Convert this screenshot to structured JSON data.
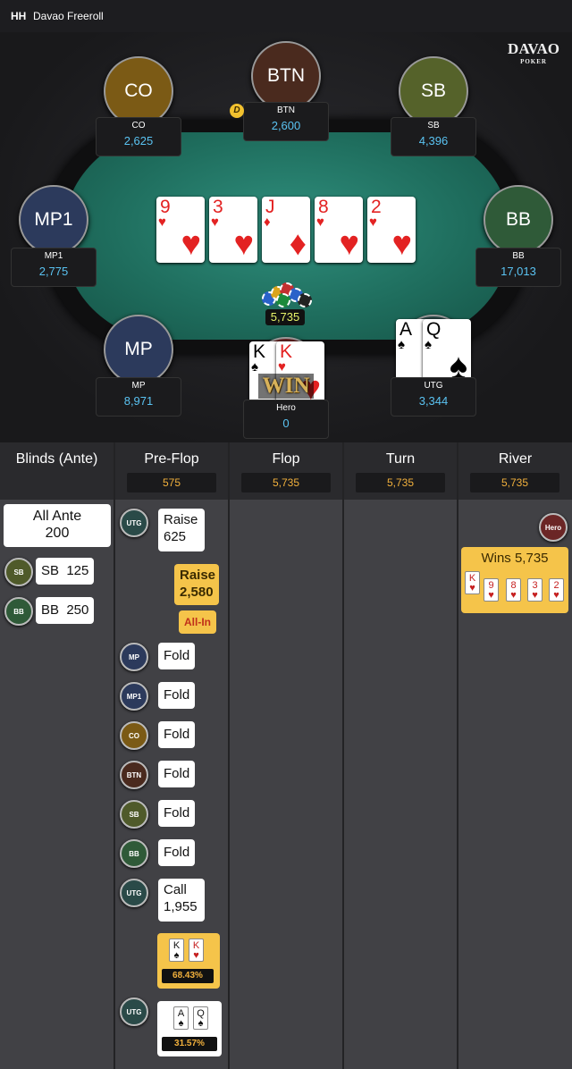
{
  "header": {
    "prefix": "HH",
    "title": "Davao Freeroll"
  },
  "logo": {
    "line1": "DAVAO",
    "line2": "POKER"
  },
  "seats": [
    {
      "id": "co",
      "label": "CO",
      "name": "CO",
      "stack": "2,625",
      "color": "#7b5a15"
    },
    {
      "id": "btn",
      "label": "BTN",
      "name": "BTN",
      "stack": "2,600",
      "color": "#4a2a1e"
    },
    {
      "id": "sb",
      "label": "SB",
      "name": "SB",
      "stack": "4,396",
      "color": "#55622a"
    },
    {
      "id": "mp1",
      "label": "MP1",
      "name": "MP1",
      "stack": "2,775",
      "color": "#2c3a5c"
    },
    {
      "id": "bb",
      "label": "BB",
      "name": "BB",
      "stack": "17,013",
      "color": "#2f5a38"
    },
    {
      "id": "mp",
      "label": "MP",
      "name": "MP",
      "stack": "8,971",
      "color": "#2c3a5c"
    },
    {
      "id": "hero",
      "label": "",
      "name": "Hero",
      "stack": "0",
      "color": "#6b2626"
    },
    {
      "id": "utg",
      "label": "",
      "name": "UTG",
      "stack": "3,344",
      "color": "#2a4a48"
    }
  ],
  "dealer_icon": "D",
  "board": [
    {
      "rank": "9",
      "suit": "♥"
    },
    {
      "rank": "3",
      "suit": "♥"
    },
    {
      "rank": "J",
      "suit": "♦"
    },
    {
      "rank": "8",
      "suit": "♥"
    },
    {
      "rank": "2",
      "suit": "♥"
    }
  ],
  "pot": "5,735",
  "hero_cards": [
    {
      "rank": "K",
      "suit": "♠",
      "black": true
    },
    {
      "rank": "K",
      "suit": "♥",
      "black": false
    }
  ],
  "utg_cards": [
    {
      "rank": "A",
      "suit": "♠",
      "black": true
    },
    {
      "rank": "Q",
      "suit": "♠",
      "black": true
    }
  ],
  "win_label": "WIN",
  "columns": [
    {
      "title": "Blinds (Ante)",
      "pot": ""
    },
    {
      "title": "Pre-Flop",
      "pot": "575"
    },
    {
      "title": "Flop",
      "pot": "5,735"
    },
    {
      "title": "Turn",
      "pot": "5,735"
    },
    {
      "title": "River",
      "pot": "5,735"
    }
  ],
  "blinds": {
    "ante_line1": "All Ante",
    "ante_line2": "200",
    "sb_chip": "SB",
    "sb_text": "SB  125",
    "bb_chip": "BB",
    "bb_text": "BB  250"
  },
  "preflop": {
    "utg_chip": "UTG",
    "raise1_line1": "Raise",
    "raise1_line2": "625",
    "raise2_line1": "Raise",
    "raise2_line2": "2,580",
    "allin": "All-In",
    "folds": [
      {
        "chip": "MP",
        "text": "Fold"
      },
      {
        "chip": "MP1",
        "text": "Fold"
      },
      {
        "chip": "CO",
        "text": "Fold"
      },
      {
        "chip": "BTN",
        "text": "Fold"
      },
      {
        "chip": "SB",
        "text": "Fold"
      },
      {
        "chip": "BB",
        "text": "Fold"
      }
    ],
    "call_chip": "UTG",
    "call_line1": "Call",
    "call_line2": "1,955",
    "hero_cards": [
      {
        "rank": "K",
        "suit": "♠"
      },
      {
        "rank": "K",
        "suit": "♥"
      }
    ],
    "hero_equity": "68.43%",
    "utg_chip2": "UTG",
    "utg_cards": [
      {
        "rank": "A",
        "suit": "♠"
      },
      {
        "rank": "Q",
        "suit": "♠"
      }
    ],
    "utg_equity": "31.57%"
  },
  "river": {
    "hero_chip": "Hero",
    "wins_text": "Wins 5,735",
    "cards": [
      {
        "rank": "K",
        "suit": "♥"
      },
      {
        "rank": "9",
        "suit": "♥"
      },
      {
        "rank": "8",
        "suit": "♥"
      },
      {
        "rank": "3",
        "suit": "♥"
      },
      {
        "rank": "2",
        "suit": "♥"
      }
    ]
  },
  "colors": {
    "stack": "#5ac3f2",
    "pot_tag": "#f1b03c",
    "gold": "#f5c44a",
    "felt": "#1f6e5e"
  }
}
